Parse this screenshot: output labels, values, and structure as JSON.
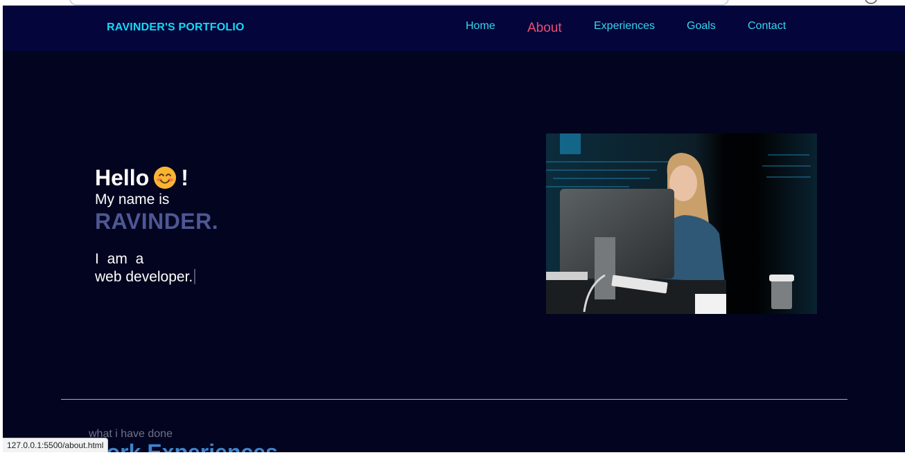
{
  "nav": {
    "brand": "RAVINDER'S PORTFOLIO",
    "links": [
      {
        "label": "Home"
      },
      {
        "label": "About",
        "active": true
      },
      {
        "label": "Experiences"
      },
      {
        "label": "Goals"
      },
      {
        "label": "Contact"
      }
    ]
  },
  "hero": {
    "greeting": "Hello",
    "greeting_emoji_icon": "smiling-face-icon",
    "exclamation": "!",
    "name_intro": "My name is",
    "name": "RAVINDER.",
    "iam": "I am a",
    "role": "web developer."
  },
  "section": {
    "kicker": "what i have done",
    "title": "Work Experiences"
  },
  "status_bar": {
    "url": "127.0.0.1:5500/about.html"
  },
  "colors": {
    "background": "#03041f",
    "navbar": "#03053b",
    "brand": "#16d8f4",
    "nav_link": "#35d7ee",
    "nav_active": "#ee4e70",
    "name_accent": "#4d5794",
    "section_title": "#3d86d0"
  }
}
